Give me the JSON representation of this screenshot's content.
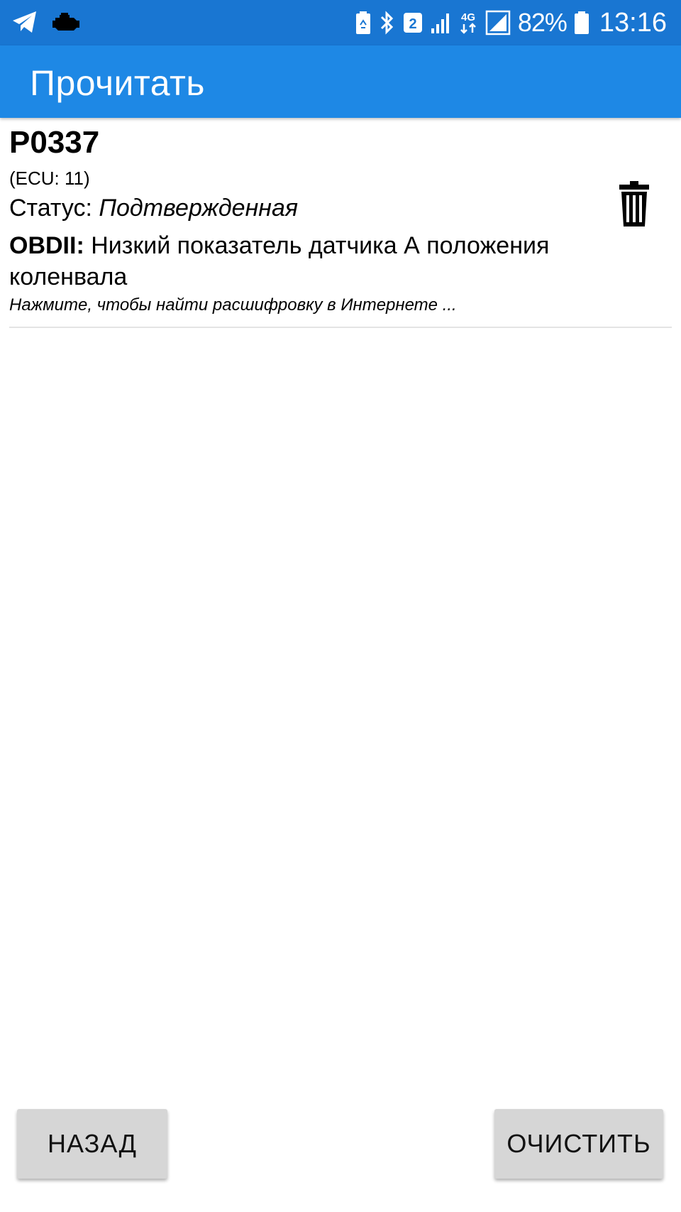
{
  "status_bar": {
    "icons_left": [
      "telegram-icon",
      "check-engine-icon"
    ],
    "icons_right": [
      "battery-saver-icon",
      "bluetooth-icon",
      "sim2-icon",
      "signal-icon",
      "network-4g-icon",
      "signal-full-icon",
      "battery-icon"
    ],
    "sim_number": "2",
    "network_label": "4G",
    "battery_percent": "82%",
    "time": "13:16"
  },
  "app_bar": {
    "title": "Прочитать"
  },
  "errors": [
    {
      "code": "P0337",
      "ecu": "(ECU: 11)",
      "status_label": "Статус:",
      "status_value": "Подтвержденная",
      "obd_label": "OBDII:",
      "description": "Низкий показатель датчика А положения коленвала",
      "hint": "Нажмите, чтобы найти расшифровку в Интернете ..."
    }
  ],
  "buttons": {
    "back": "НАЗАД",
    "clear": "ОЧИСТИТЬ"
  },
  "colors": {
    "status_bar": "#1976d2",
    "app_bar": "#1e88e5",
    "button_bg": "#d6d6d6"
  }
}
